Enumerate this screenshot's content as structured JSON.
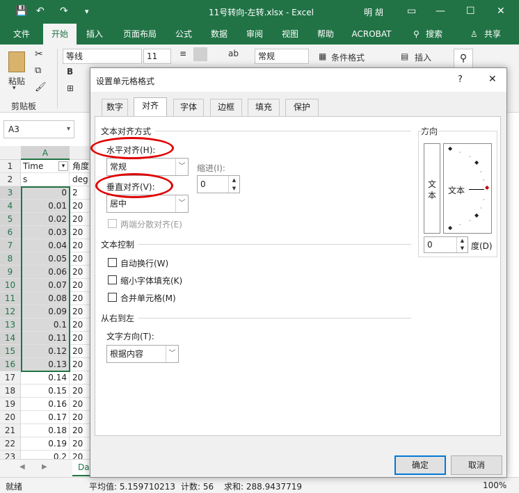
{
  "titlebar": {
    "title": "11号转向-左转.xlsx  -  Excel",
    "user": "明 胡",
    "save_icon": "save-icon",
    "undo_icon": "undo-icon",
    "redo_icon": "redo-icon",
    "bg": "#217346"
  },
  "ribbon_tabs": [
    "文件",
    "开始",
    "插入",
    "页面布局",
    "公式",
    "数据",
    "审阅",
    "视图",
    "帮助",
    "ACROBAT"
  ],
  "ribbon": {
    "search": "搜索",
    "share": "共享",
    "paste": "粘贴",
    "clipboard": "剪贴板",
    "font_name": "等线",
    "font_size": "11",
    "number_format": "常规",
    "conditional": "条件格式",
    "insert": "插入",
    "bold": "B"
  },
  "formula": {
    "name_box": "A3"
  },
  "grid": {
    "col_a": "A",
    "header_a": "Time",
    "header_b": "角度",
    "unit_a": "s",
    "unit_b": "deg",
    "rows": [
      "1",
      "2",
      "3",
      "4",
      "5",
      "6",
      "7",
      "8",
      "9",
      "10",
      "11",
      "12",
      "13",
      "14",
      "15",
      "16",
      "17",
      "18",
      "19",
      "20",
      "21",
      "22",
      "23"
    ],
    "values": [
      "0",
      "0.01",
      "0.02",
      "0.03",
      "0.04",
      "0.05",
      "0.06",
      "0.07",
      "0.08",
      "0.09",
      "0.1",
      "0.11",
      "0.12",
      "0.13",
      "0.14",
      "0.15",
      "0.16",
      "0.17",
      "0.18",
      "0.19",
      "0.2"
    ],
    "b_values": [
      "2",
      "20",
      "20",
      "20",
      "20",
      "20",
      "20",
      "20",
      "20",
      "20",
      "20",
      "20",
      "20",
      "20",
      "20",
      "20",
      "20",
      "20",
      "20",
      "20",
      "20"
    ],
    "sheet_tab": "Da"
  },
  "statusbar": {
    "ready": "就绪",
    "average": "平均值: 5.159710213",
    "count": "计数: 56",
    "sum": "求和: 288.9437719",
    "zoom": "100%"
  },
  "dialog": {
    "title": "设置单元格格式",
    "help": "?",
    "tabs": [
      "数字",
      "对齐",
      "字体",
      "边框",
      "填充",
      "保护"
    ],
    "text_align_section": "文本对齐方式",
    "horizontal_label": "水平对齐(H):",
    "horizontal_value": "常规",
    "indent_label": "缩进(I):",
    "indent_value": "0",
    "vertical_label": "垂直对齐(V):",
    "vertical_value": "居中",
    "justify_distributed": "两端分散对齐(E)",
    "text_control_section": "文本控制",
    "wrap_text": "自动换行(W)",
    "shrink_to_fit": "缩小字体填充(K)",
    "merge_cells": "合并单元格(M)",
    "rtl_section": "从右到左",
    "text_direction_label": "文字方向(T):",
    "text_direction_value": "根据内容",
    "orientation_section": "方向",
    "vertical_text": "文本",
    "orientation_text": "文本",
    "degree_value": "0",
    "degree_label": "度(D)",
    "ok": "确定",
    "cancel": "取消",
    "annotation_color": "#e00000"
  }
}
